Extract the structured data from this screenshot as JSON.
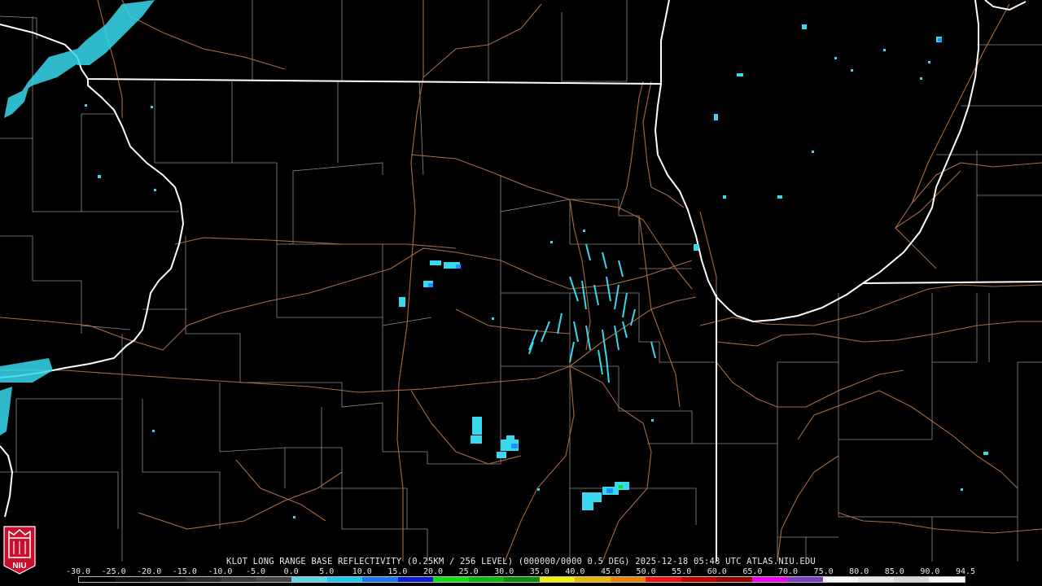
{
  "product": {
    "caption": "KLOT LONG RANGE BASE REFLECTIVITY (0.25KM / 256 LEVEL) (000000/0000 0.5 DEG) 2025-12-18 05:48 UTC  ATLAS.NIU.EDU"
  },
  "legend": {
    "ticks": [
      "-30.0",
      "-25.0",
      "-20.0",
      "-15.0",
      "-10.0",
      "-5.0",
      "0.0",
      "5.0",
      "10.0",
      "15.0",
      "20.0",
      "25.0",
      "30.0",
      "35.0",
      "40.0",
      "45.0",
      "50.0",
      "55.0",
      "60.0",
      "65.0",
      "70.0",
      "75.0",
      "80.0",
      "85.0",
      "90.0",
      "94.5"
    ],
    "colors": [
      "#000000",
      "#101010",
      "#1c1c1c",
      "#2a2a2a",
      "#383838",
      "#474747",
      "#58d8e8",
      "#1ec8f0",
      "#1878f0",
      "#0a1cd0",
      "#10e010",
      "#0ab80a",
      "#068e06",
      "#f0f000",
      "#e8b800",
      "#f08000",
      "#f01010",
      "#c00000",
      "#900000",
      "#f000f0",
      "#8040c0",
      "#f8f8f8",
      "#e8e8e8",
      "#d8d8d8",
      "#f8f8f8"
    ]
  },
  "logo": {
    "text": "NIU"
  },
  "colors": {
    "state_border": "#ffffff",
    "county_border": "#8c8c8c",
    "highway": "#a86a44",
    "echo_light": "#38d8ee",
    "echo_blue": "#1e90ff",
    "background": "#000000"
  }
}
